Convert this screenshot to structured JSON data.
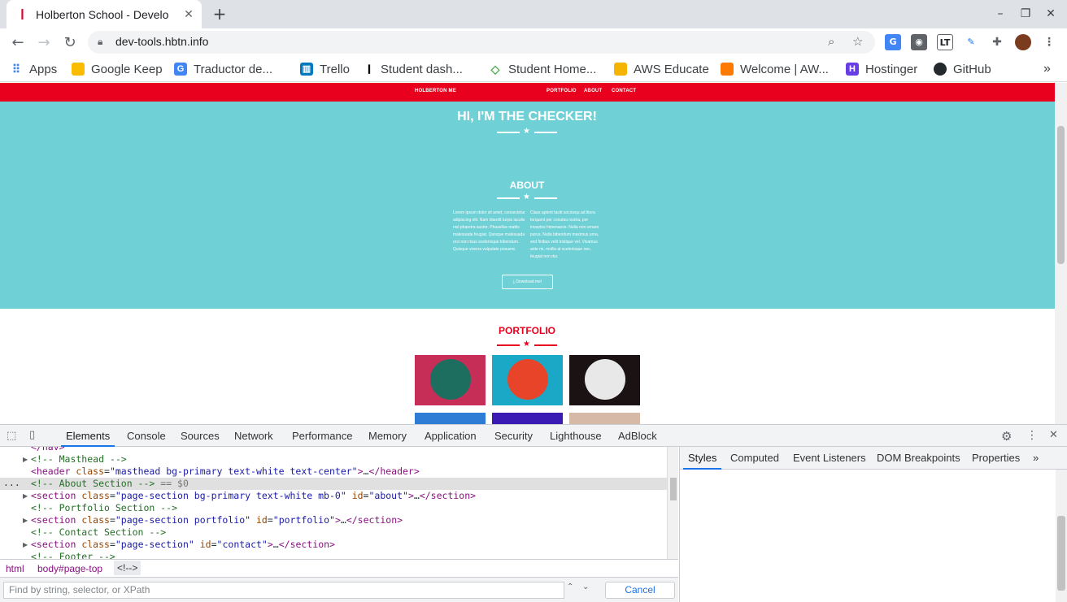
{
  "browser": {
    "tab_title": "Holberton School - Develo",
    "new_tab_symbol": "+",
    "url": "dev-tools.hbtn.info",
    "window_controls": {
      "minimize": "–",
      "restore": "❐",
      "close": "✕"
    },
    "bookmarks": [
      {
        "label": "Apps",
        "icon": "apps-grid-icon",
        "color": "#4285f4"
      },
      {
        "label": "Google Keep",
        "icon": "google-keep-icon",
        "color": "#fbbc04"
      },
      {
        "label": "Traductor de...",
        "icon": "google-translate-icon",
        "color": "#4285f4"
      },
      {
        "label": "Trello",
        "icon": "trello-icon",
        "color": "#0079bf"
      },
      {
        "label": "Student dash...",
        "icon": "holberton-icon",
        "color": "#000000"
      },
      {
        "label": "Student Home...",
        "icon": "student-home-icon",
        "color": "#4caf50"
      },
      {
        "label": "AWS Educate",
        "icon": "aws-educate-icon",
        "color": "#f4b400"
      },
      {
        "label": "Welcome | AW...",
        "icon": "aws-icon",
        "color": "#ff7a00"
      },
      {
        "label": "Hostinger",
        "icon": "hostinger-icon",
        "color": "#673de6"
      },
      {
        "label": "GitHub",
        "icon": "github-icon",
        "color": "#24292e"
      }
    ],
    "bookmarks_overflow": "»"
  },
  "page": {
    "nav_brand": "HOLBERTON ME",
    "nav_links": [
      "PORTFOLIO",
      "ABOUT",
      "CONTACT"
    ],
    "masthead_title": "HI, I'M THE CHECKER!",
    "about_title": "ABOUT",
    "about_col1": "Lorem ipsum dolor sit amet, consectetur adipiscing elit. Nam blandit turpis iaculis nisl pharetra auctor. Phasellus mattis malesuada feugiat. Quisque malesuada orci non risus scelerisque bibendum. Quisque viverra vulputate posuere.",
    "about_col2": "Class aptent taciti sociosqu ad litora torquent per conubia nostra, per inceptos himenaeos. Nulla non ornare purus. Nulla bibendum maximus urna, sed finibus velit tristique vel. Vivamus ante mi, mollis at scelerisque nec, feugiat non dui.",
    "download_label": "Download me!",
    "portfolio_title": "PORTFOLIO",
    "colors": {
      "primary_red": "#e8001e",
      "teal": "#6fd0d6"
    }
  },
  "devtools": {
    "tabs": [
      "Elements",
      "Console",
      "Sources",
      "Network",
      "Performance",
      "Memory",
      "Application",
      "Security",
      "Lighthouse",
      "AdBlock"
    ],
    "active_tab": "Elements",
    "code_lines": [
      {
        "t": "</nav>"
      },
      {
        "t": "<!-- Masthead -->"
      },
      {
        "t": "<header class=\"masthead bg-primary text-white text-center\">…</header>"
      },
      {
        "t": "<!-- About Section --> == $0"
      },
      {
        "t": "<section class=\"page-section bg-primary text-white mb-0\" id=\"about\">…</section>"
      },
      {
        "t": "<!-- Portfolio Section -->"
      },
      {
        "t": "<section class=\"page-section portfolio\" id=\"portfolio\">…</section>"
      },
      {
        "t": "<!-- Contact Section -->"
      },
      {
        "t": "<section class=\"page-section\" id=\"contact\">…</section>"
      },
      {
        "t": "<!-- Footer -->"
      }
    ],
    "side_tabs": [
      "Styles",
      "Computed",
      "Event Listeners",
      "DOM Breakpoints",
      "Properties"
    ],
    "side_overflow": "»",
    "breadcrumbs": [
      "html",
      "body#page-top",
      "<!--> "
    ],
    "find_placeholder": "Find by string, selector, or XPath",
    "cancel_label": "Cancel",
    "ellipsis": "..."
  }
}
